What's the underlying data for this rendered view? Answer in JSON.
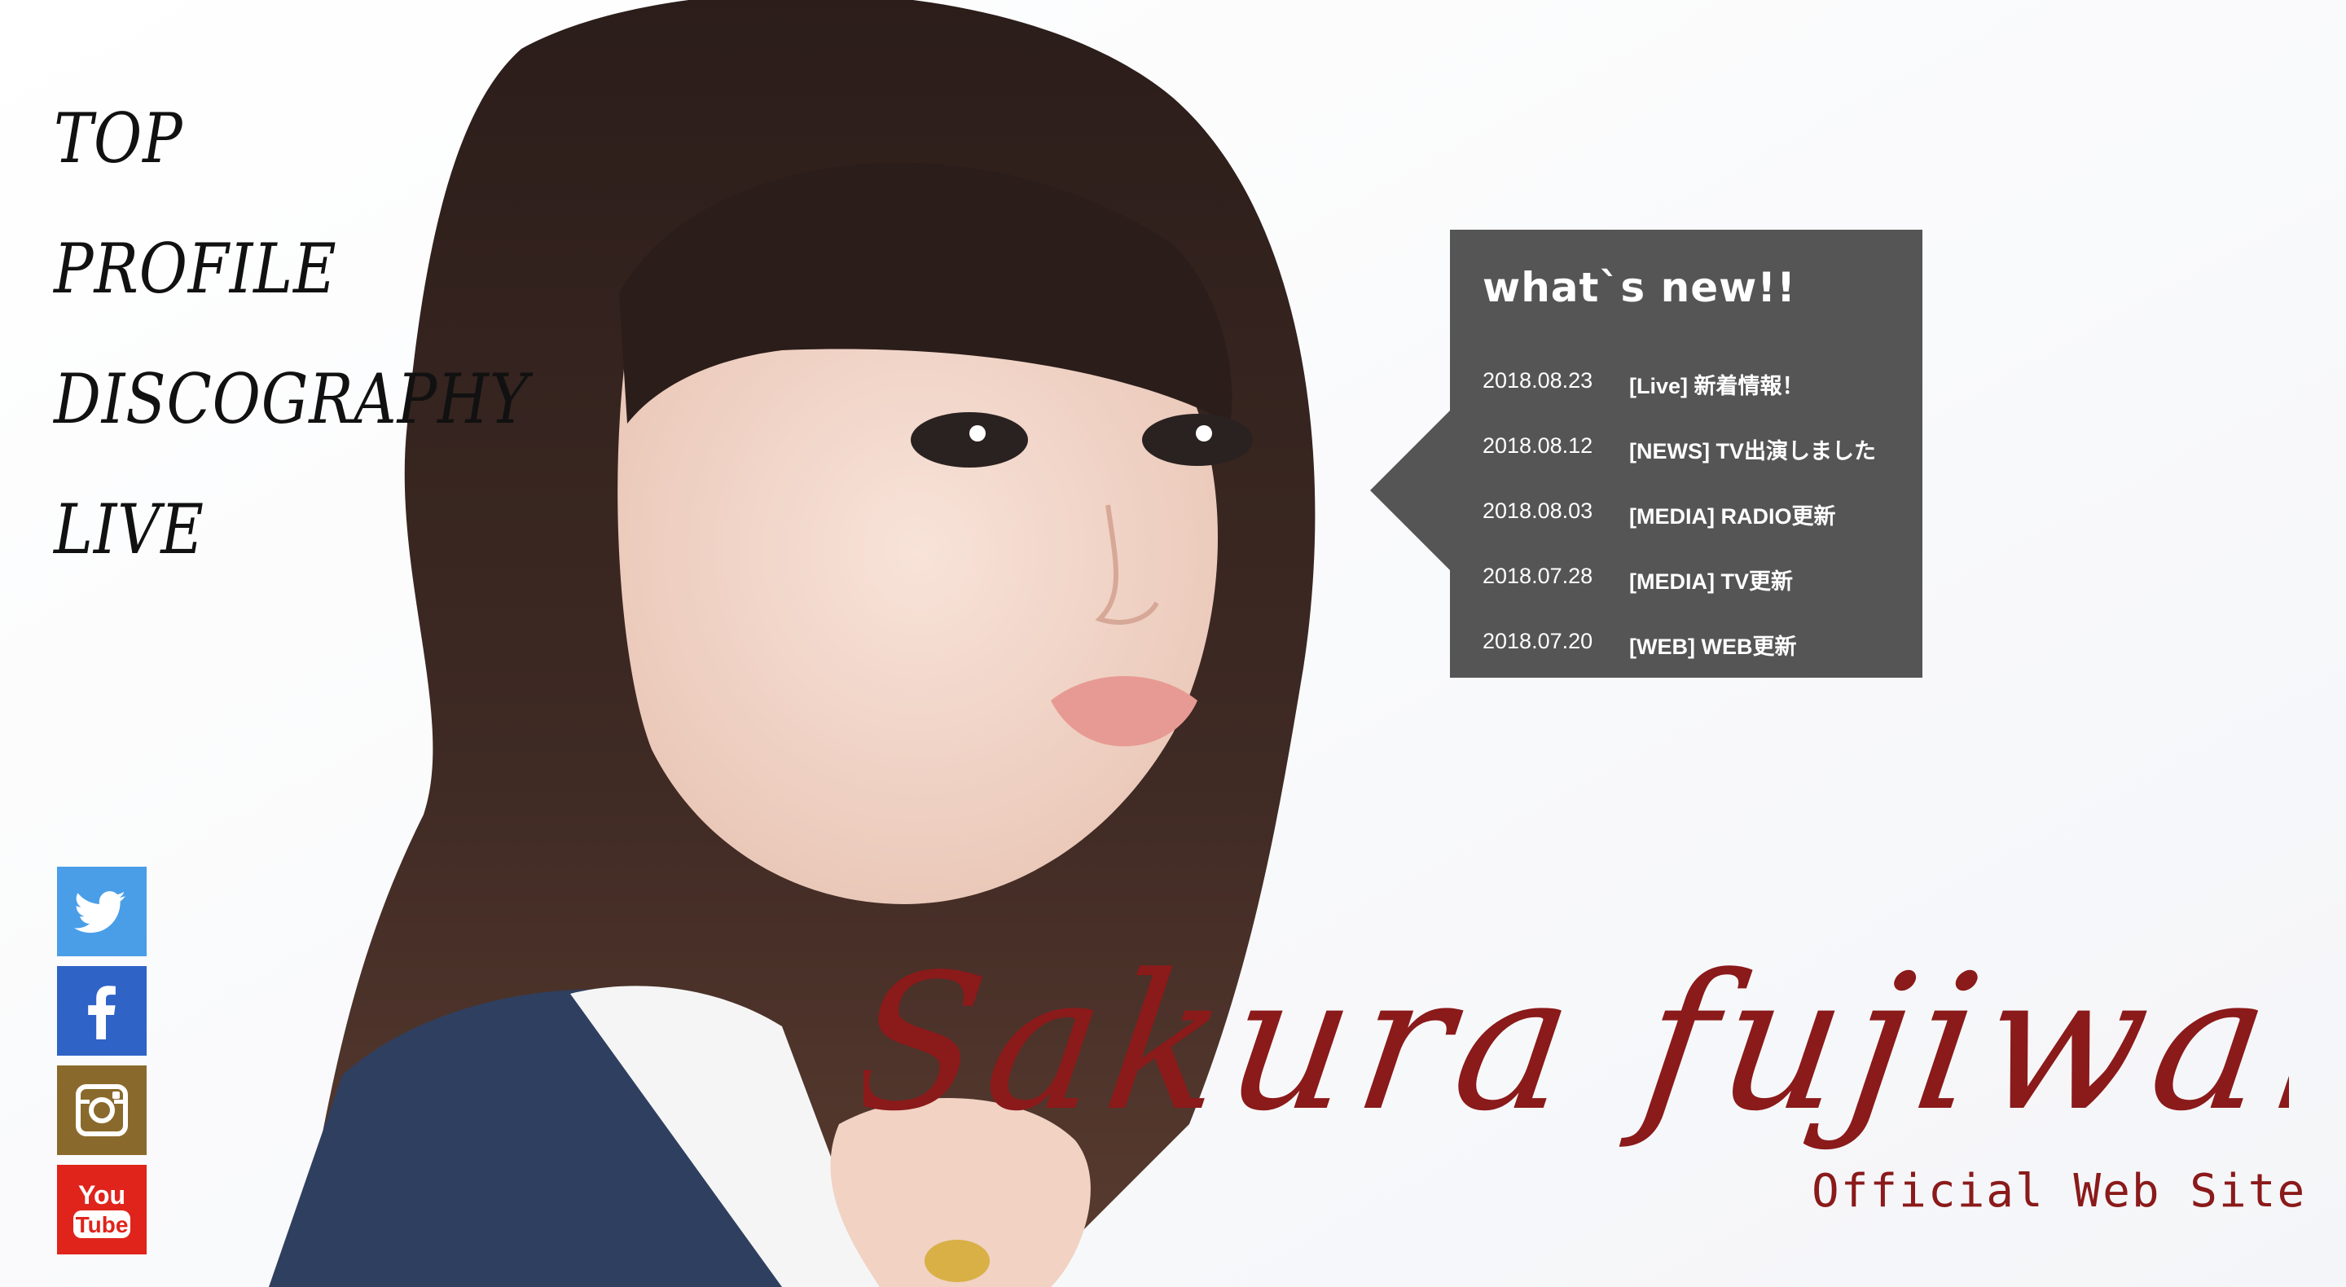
{
  "nav": {
    "items": [
      {
        "label": "TOP"
      },
      {
        "label": "PROFILE"
      },
      {
        "label": "DISCOGRAPHY"
      },
      {
        "label": "LIVE"
      }
    ]
  },
  "news": {
    "title": "what`s new!!",
    "items": [
      {
        "date": "2018.08.23",
        "text": "[Live] 新着情報！"
      },
      {
        "date": "2018.08.12",
        "text": "[NEWS] TV出演しました"
      },
      {
        "date": "2018.08.03",
        "text": "[MEDIA] RADIO更新"
      },
      {
        "date": "2018.07.28",
        "text": "[MEDIA] TV更新"
      },
      {
        "date": "2018.07.20",
        "text": "[WEB] WEB更新"
      }
    ]
  },
  "social": {
    "items": [
      {
        "name": "twitter",
        "icon": "twitter-icon",
        "color": "#4a9ee8"
      },
      {
        "name": "facebook",
        "icon": "facebook-icon",
        "color": "#2f63c6"
      },
      {
        "name": "instagram",
        "icon": "instagram-icon",
        "color": "#8a6a2c"
      },
      {
        "name": "youtube",
        "icon": "youtube-icon",
        "color": "#e0241b",
        "label_top": "You",
        "label_bottom": "Tube"
      }
    ]
  },
  "brand": {
    "signature": "Sakura fujiwara",
    "subtitle": "Official Web Site",
    "color": "#8b1a1a"
  }
}
